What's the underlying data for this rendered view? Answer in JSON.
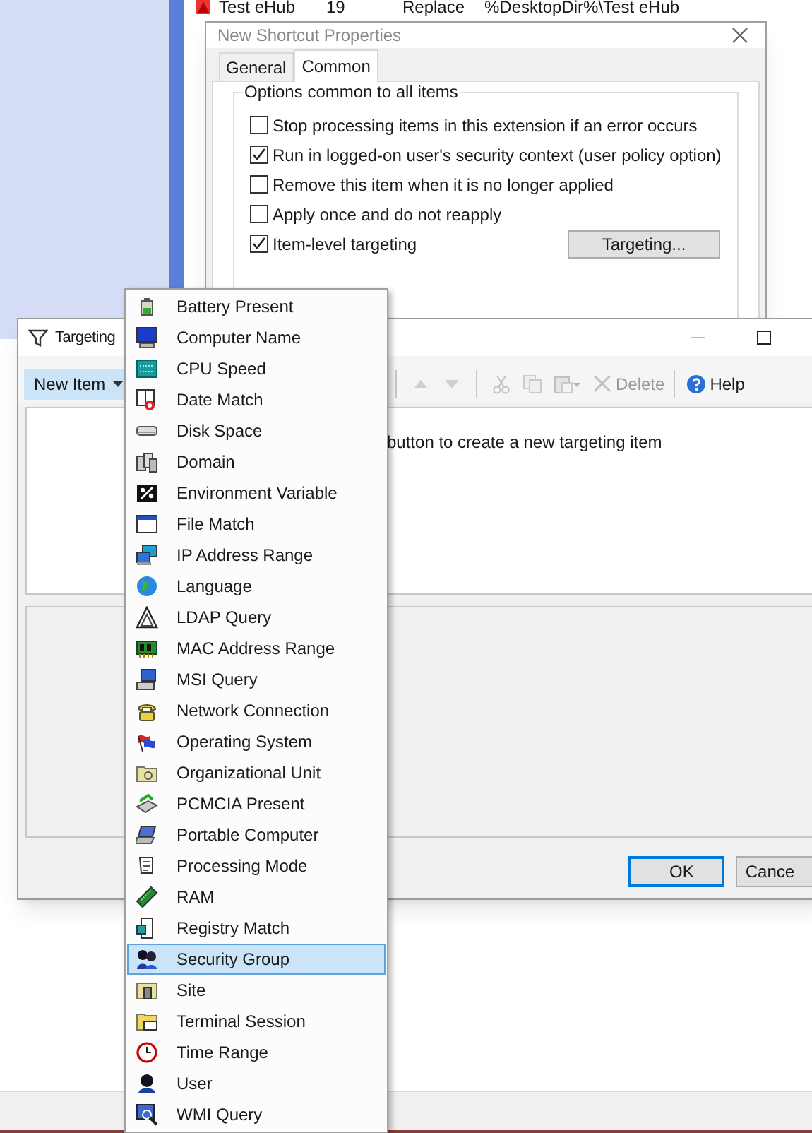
{
  "background_row": {
    "name": "Test eHub",
    "column_2": "19",
    "column_3": "Replace",
    "column_4": "%DesktopDir%\\Test eHub"
  },
  "properties_dialog": {
    "title": "New Shortcut Properties",
    "tabs": [
      {
        "label": "General",
        "selected": false
      },
      {
        "label": "Common",
        "selected": true
      }
    ],
    "group_title": "Options common to all items",
    "options": [
      {
        "label": "Stop processing items in this extension if an error occurs",
        "checked": false
      },
      {
        "label": "Run in logged-on user's security context (user policy option)",
        "checked": true
      },
      {
        "label": "Remove this item when it is no longer applied",
        "checked": false
      },
      {
        "label": "Apply once and do not reapply",
        "checked": false
      },
      {
        "label": "Item-level targeting",
        "checked": true
      }
    ],
    "targeting_button": "Targeting..."
  },
  "targeting_window": {
    "title": "Targeting",
    "new_item_button": "New Item",
    "toolbar": [
      {
        "kind": "move_up",
        "disabled": true
      },
      {
        "kind": "move_down",
        "disabled": true
      },
      {
        "kind": "cut",
        "disabled": true
      },
      {
        "kind": "copy",
        "disabled": true
      },
      {
        "kind": "paste",
        "disabled": true
      },
      {
        "kind": "delete",
        "label": "Delete",
        "disabled": true
      },
      {
        "kind": "help",
        "label": "Help",
        "disabled": false
      }
    ],
    "hint": "button to create a new targeting item",
    "buttons": [
      "OK",
      "Cance"
    ]
  },
  "new_item_menu": {
    "items": [
      {
        "label": "Battery Present",
        "selected": false
      },
      {
        "label": "Computer Name",
        "selected": false
      },
      {
        "label": "CPU Speed",
        "selected": false
      },
      {
        "label": "Date Match",
        "selected": false
      },
      {
        "label": "Disk Space",
        "selected": false
      },
      {
        "label": "Domain",
        "selected": false
      },
      {
        "label": "Environment Variable",
        "selected": false
      },
      {
        "label": "File Match",
        "selected": false
      },
      {
        "label": "IP Address Range",
        "selected": false
      },
      {
        "label": "Language",
        "selected": false
      },
      {
        "label": "LDAP Query",
        "selected": false
      },
      {
        "label": "MAC Address Range",
        "selected": false
      },
      {
        "label": "MSI Query",
        "selected": false
      },
      {
        "label": "Network Connection",
        "selected": false
      },
      {
        "label": "Operating System",
        "selected": false
      },
      {
        "label": "Organizational Unit",
        "selected": false
      },
      {
        "label": "PCMCIA Present",
        "selected": false
      },
      {
        "label": "Portable Computer",
        "selected": false
      },
      {
        "label": "Processing Mode",
        "selected": false
      },
      {
        "label": "RAM",
        "selected": false
      },
      {
        "label": "Registry Match",
        "selected": false
      },
      {
        "label": "Security Group",
        "selected": true
      },
      {
        "label": "Site",
        "selected": false
      },
      {
        "label": "Terminal Session",
        "selected": false
      },
      {
        "label": "Time Range",
        "selected": false
      },
      {
        "label": "User",
        "selected": false
      },
      {
        "label": "WMI Query",
        "selected": false
      }
    ]
  }
}
